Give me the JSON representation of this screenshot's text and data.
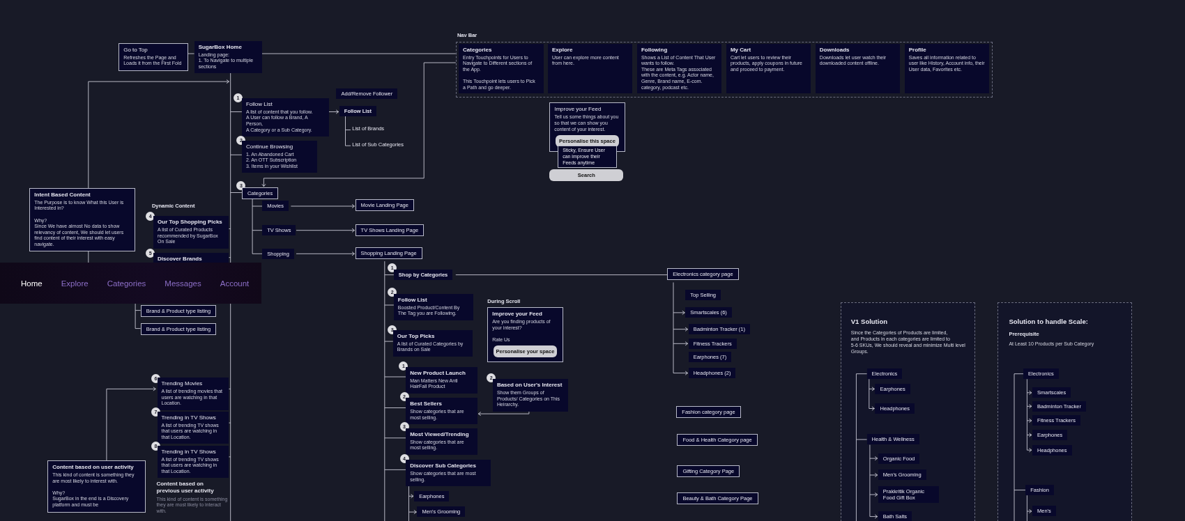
{
  "nodes": [
    {
      "kind": "card",
      "title": "Go to Top",
      "text": "Refreshes the Page and Loads it from the First Fold",
      "outlined": true,
      "strong": false
    },
    {
      "kind": "card",
      "title": "SugarBox Home",
      "text": "Landing page:\n   1.  To Navigate to multiple sections",
      "outlined": false,
      "strong": true
    },
    {
      "kind": "label",
      "text": "Nav Bar",
      "strong": true
    },
    {
      "kind": "card",
      "title": "Categories",
      "text": "Entry Touchpoints for Users to Navigate to Different sections of the App.\n\nThis Touchpoint lets users to Pick a Path and go deeper.",
      "outlined": false,
      "strong": true
    },
    {
      "kind": "card",
      "title": "Explore",
      "text": "User can explore more content from here.",
      "outlined": false,
      "strong": true
    },
    {
      "kind": "card",
      "title": "Following",
      "text": "Shows a List of Content That User wants to follow.\nThese are Meta Tags associated with the content, e.g. Actor name, Genre, Brand name, E-com. category, podcast etc.",
      "outlined": false,
      "strong": true
    },
    {
      "kind": "card",
      "title": "My Cart",
      "text": "Cart let users to review their products, apply coupons in future and proceed to payment.",
      "outlined": false,
      "strong": true
    },
    {
      "kind": "card",
      "title": "Downloads",
      "text": "Downloads let user watch their downloaded content offline.",
      "outlined": false,
      "strong": true
    },
    {
      "kind": "card",
      "title": "Profile",
      "text": "Saves all information related to user like History, Account info, their User data, Favorites etc.",
      "outlined": false,
      "strong": true
    },
    {
      "kind": "card",
      "title": "Improve your Feed",
      "text": "Tell us some things about you so that we can show you content of your interest.",
      "button": "Personalise this space",
      "outlined": true,
      "strong": false
    },
    {
      "kind": "note",
      "text": "Sticky, Ensure User can improve their Feeds anytime"
    },
    {
      "kind": "button",
      "text": "Search"
    },
    {
      "kind": "badge",
      "text": "1"
    },
    {
      "kind": "card",
      "title": "Follow List",
      "text": "A list of content that you follow.\nA User can follow a Brand, A Person,\nA Category or a Sub Category.",
      "outlined": false,
      "strong": false
    },
    {
      "kind": "tag",
      "text": "Add/Remove Follower",
      "outlined": false,
      "strong": false
    },
    {
      "kind": "tag",
      "text": "Follow List",
      "outlined": false,
      "strong": true
    },
    {
      "kind": "label",
      "text": "List of Brands",
      "strong": false
    },
    {
      "kind": "label",
      "text": "List of Sub Categories",
      "strong": false
    },
    {
      "kind": "badge",
      "text": "2"
    },
    {
      "kind": "card",
      "title": "Continue Browsing",
      "text": "1. An Abandoned Cart\n2. An OTT Subscription\n3. Items in your Wishlist",
      "outlined": false,
      "strong": false
    },
    {
      "kind": "badge",
      "text": "3"
    },
    {
      "kind": "tag",
      "text": "Categories",
      "outlined": true,
      "strong": false
    },
    {
      "kind": "tag",
      "text": "Movies",
      "outlined": false,
      "strong": false
    },
    {
      "kind": "tag",
      "text": "TV Shows",
      "outlined": false,
      "strong": false
    },
    {
      "kind": "tag",
      "text": "Shopping",
      "outlined": false,
      "strong": false
    },
    {
      "kind": "tag",
      "text": "Movie Landing Page",
      "outlined": true,
      "strong": false
    },
    {
      "kind": "tag",
      "text": "TV Shows Landing Page",
      "outlined": true,
      "strong": false
    },
    {
      "kind": "tag",
      "text": "Shopping Landing Page",
      "outlined": true,
      "strong": false
    },
    {
      "kind": "card",
      "title": "Intent Based Content",
      "text": "The Purpose is to know What this User is Interested in?\n\nWhy?\nSince We have almost No data to show relevancy of content, We should let users find content of their interest with easy navigate.",
      "outlined": true,
      "strong": true
    },
    {
      "kind": "label",
      "text": "Dynamic Content",
      "strong": true
    },
    {
      "kind": "badge",
      "text": "4"
    },
    {
      "kind": "card",
      "title": "Our Top Shopping Picks",
      "text": "A list of Curated Products recommended by SugarBox\nOn Sale",
      "outlined": false,
      "strong": true
    },
    {
      "kind": "badge",
      "text": "5"
    },
    {
      "kind": "card",
      "title": "Discover Brands",
      "outlined": false,
      "strong": true
    },
    {
      "kind": "tag",
      "text": "Brand & Product type listing",
      "outlined": true,
      "strong": false
    },
    {
      "kind": "tag",
      "text": "Brand & Product type listing",
      "outlined": true,
      "strong": false
    },
    {
      "kind": "badge",
      "text": "6"
    },
    {
      "kind": "card",
      "title": "Trending Movies",
      "text": "A list of trending movies that users are watching in that Location.",
      "outlined": false,
      "strong": false
    },
    {
      "kind": "badge",
      "text": "7"
    },
    {
      "kind": "card",
      "title": "Trending in TV Shows",
      "text": "A list of trending TV shows that users are watching in that Location.",
      "outlined": false,
      "strong": false
    },
    {
      "kind": "badge",
      "text": "8"
    },
    {
      "kind": "card",
      "title": "Trending in TV Shows",
      "text": "A list of trending TV shows that users are watching in that Location.",
      "outlined": false,
      "strong": false
    },
    {
      "kind": "card",
      "title": "Content based on user activity",
      "text": "This kind of content is something they are most likely to interest with.\n\nWhy?\nSugarBox in the end is a Discovery platform and must be",
      "outlined": true,
      "strong": true
    },
    {
      "kind": "caption",
      "title": "Content based on\nprevious user activity",
      "text": "This kind of content is something they are most likely to interact with."
    },
    {
      "kind": "badge",
      "text": "1"
    },
    {
      "kind": "tag",
      "text": "Shop by Categories",
      "outlined": false,
      "strong": true
    },
    {
      "kind": "badge",
      "text": "2"
    },
    {
      "kind": "card",
      "title": "Follow List",
      "text": "Boosted Product/Content By The Tag you are Following.",
      "outlined": false,
      "strong": true
    },
    {
      "kind": "badge",
      "text": "3"
    },
    {
      "kind": "card",
      "title": "Our Top Picks",
      "text": "A list of Curated Categories by Brands on Sale",
      "outlined": false,
      "strong": true
    },
    {
      "kind": "label",
      "text": "During Scroll",
      "strong": true
    },
    {
      "kind": "card",
      "title": "Improve your Feed",
      "text": "Are you finding products of your interest?\n\nRate Us",
      "button": "Personalise your space",
      "outlined": true,
      "strong": true
    },
    {
      "kind": "badge",
      "text": "1"
    },
    {
      "kind": "card",
      "title": "New Product Launch",
      "text": "Man Matters New Anti HairFall Product",
      "outlined": false,
      "strong": true
    },
    {
      "kind": "badge",
      "text": "2"
    },
    {
      "kind": "card",
      "title": "Best Sellers",
      "text": "Show categories that are most selling.",
      "outlined": false,
      "strong": true
    },
    {
      "kind": "badge",
      "text": "3"
    },
    {
      "kind": "card",
      "title": "Most Viewed/Trending",
      "text": "Show categories that are most selling.",
      "outlined": false,
      "strong": true
    },
    {
      "kind": "badge",
      "text": "4"
    },
    {
      "kind": "card",
      "title": "Discover Sub Categories",
      "text": "Show categories that are most selling.",
      "outlined": false,
      "strong": true
    },
    {
      "kind": "tag",
      "text": "Earphones",
      "outlined": false,
      "strong": false
    },
    {
      "kind": "tag",
      "text": "Men's Grooming",
      "outlined": false,
      "strong": false
    },
    {
      "kind": "badge",
      "text": "2"
    },
    {
      "kind": "card",
      "title": "Based on User's Interest",
      "text": "Show them Groups of Products/ Categories on This Heirarchy.",
      "outlined": false,
      "strong": true
    },
    {
      "kind": "tag",
      "text": "Electronics category page",
      "outlined": true,
      "strong": false
    },
    {
      "kind": "tag",
      "text": "Top Selling",
      "outlined": false,
      "strong": false
    },
    {
      "kind": "tag",
      "text": "Smartscales (6)",
      "outlined": false,
      "strong": false
    },
    {
      "kind": "tag",
      "text": "Badminton Tracker (1)",
      "outlined": false,
      "strong": false
    },
    {
      "kind": "tag",
      "text": "Fitness Trackers",
      "outlined": false,
      "strong": false
    },
    {
      "kind": "tag",
      "text": "Earphones (7)",
      "outlined": false,
      "strong": false
    },
    {
      "kind": "tag",
      "text": "Headphones (2)",
      "outlined": false,
      "strong": false
    },
    {
      "kind": "tag",
      "text": "Fashion category page",
      "outlined": true,
      "strong": false
    },
    {
      "kind": "tag",
      "text": "Food & Health Category page",
      "outlined": true,
      "strong": false
    },
    {
      "kind": "tag",
      "text": "Gifting Category Page",
      "outlined": true,
      "strong": false
    },
    {
      "kind": "tag",
      "text": "Beauty & Bath Category Page",
      "outlined": true,
      "strong": false
    },
    {
      "kind": "heading",
      "text": "V1 Solution"
    },
    {
      "kind": "paragraph",
      "text": "Since the Categories of Products are limited,\nand Products in each categories are limited to\n5-6 SKUs, We should reveal and minimize Multi level Groups."
    },
    {
      "kind": "tag",
      "text": "Electronics",
      "outlined": false,
      "strong": false
    },
    {
      "kind": "tag",
      "text": "Earphones",
      "outlined": false,
      "strong": false
    },
    {
      "kind": "tag",
      "text": "Headphones",
      "outlined": false,
      "strong": false
    },
    {
      "kind": "tag",
      "text": "Health & Wellness",
      "outlined": false,
      "strong": false
    },
    {
      "kind": "tag",
      "text": "Organic Food",
      "outlined": false,
      "strong": false
    },
    {
      "kind": "tag",
      "text": "Men's Grooming",
      "outlined": false,
      "strong": false
    },
    {
      "kind": "tag",
      "text": "Prakkritik Organic Food Gift Box",
      "outlined": false,
      "strong": false
    },
    {
      "kind": "tag",
      "text": "Bath Salts",
      "outlined": false,
      "strong": false
    },
    {
      "kind": "heading",
      "text": "Solution to handle Scale:"
    },
    {
      "kind": "label",
      "text": "Prerequisite",
      "strong": true
    },
    {
      "kind": "paragraph",
      "text": "At Least 10 Products per Sub Category"
    },
    {
      "kind": "tag",
      "text": "Electronics",
      "outlined": false,
      "strong": false
    },
    {
      "kind": "tag",
      "text": "Smartscales",
      "outlined": false,
      "strong": false
    },
    {
      "kind": "tag",
      "text": "Badminton Tracker",
      "outlined": false,
      "strong": false
    },
    {
      "kind": "tag",
      "text": "Fitness Trackers",
      "outlined": false,
      "strong": false
    },
    {
      "kind": "tag",
      "text": "Earphones",
      "outlined": false,
      "strong": false
    },
    {
      "kind": "tag",
      "text": "Headphones",
      "outlined": false,
      "strong": false
    },
    {
      "kind": "tag",
      "text": "Fashion",
      "outlined": false,
      "strong": false
    },
    {
      "kind": "tag",
      "text": "Men's",
      "outlined": false,
      "strong": false
    }
  ],
  "tab_bar": {
    "tabs": [
      {
        "label": "Home",
        "selected": true
      },
      {
        "label": "Explore",
        "selected": false
      },
      {
        "label": "Categories",
        "selected": false
      },
      {
        "label": "Messages",
        "selected": false
      },
      {
        "label": "Account",
        "selected": false
      }
    ]
  }
}
